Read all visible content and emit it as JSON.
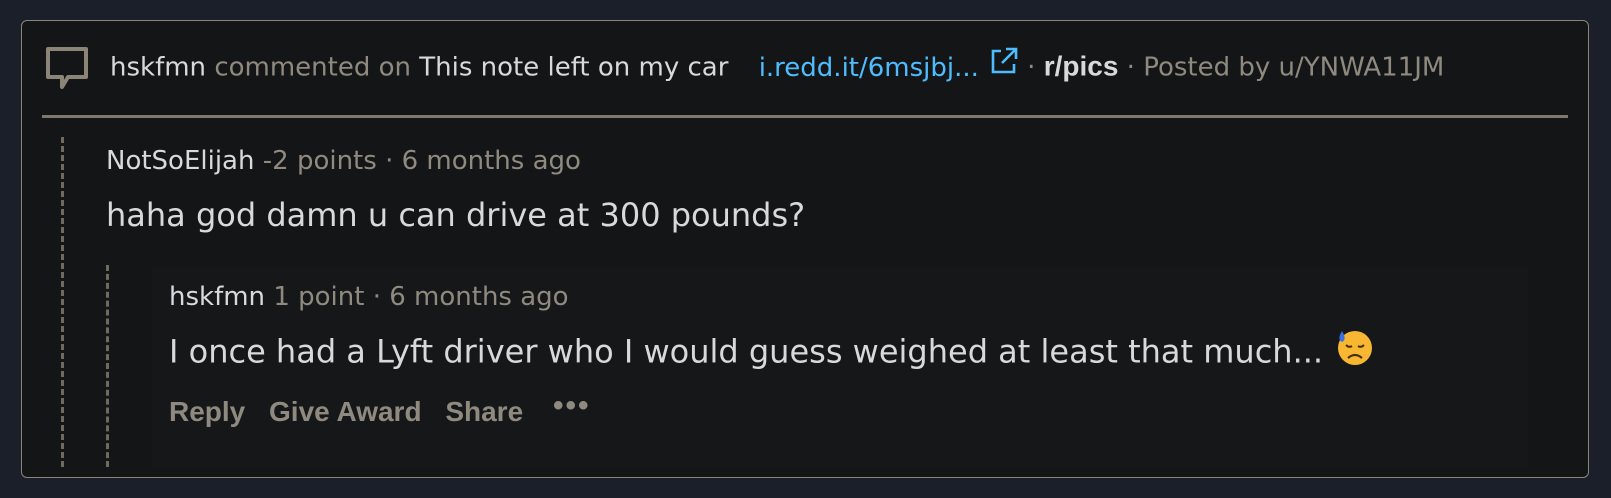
{
  "header": {
    "commenter": "hskfmn",
    "action": "commented on",
    "post_title": "This note left on my car",
    "link_text": "i.redd.it/6msjbj...",
    "separator": "·",
    "subreddit": "r/pics",
    "posted_by": "Posted by u/YNWA11JM"
  },
  "parent_comment": {
    "author": "NotSoElijah",
    "points": "-2 points",
    "separator": "·",
    "age": "6 months ago",
    "body": "haha god damn u can drive at 300 pounds?"
  },
  "reply_comment": {
    "author": "hskfmn",
    "points": "1 point",
    "separator": "·",
    "age": "6 months ago",
    "body": "I once had a Lyft driver who I would guess weighed at least that much..."
  },
  "actions": {
    "reply": "Reply",
    "give_award": "Give Award",
    "share": "Share",
    "more": "•••"
  },
  "icons": {
    "comment": "comment-bubble-icon",
    "external_link": "external-link-icon",
    "emoji": "downcast-face-with-sweat-emoji"
  },
  "colors": {
    "background": "#1a1f29",
    "card": "#141516",
    "link": "#4fbcff",
    "muted": "#8f8a80",
    "text": "#d7dadc"
  }
}
